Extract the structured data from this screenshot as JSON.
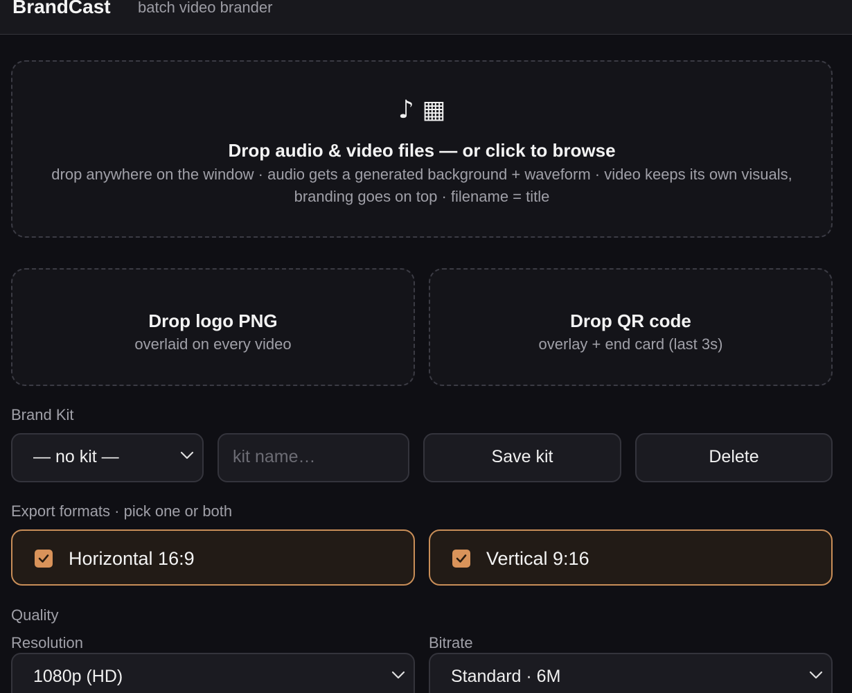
{
  "header": {
    "brand": "BrandCast",
    "tagline": "batch video brander"
  },
  "media_drop": {
    "icons": "♪ ▦",
    "title": "Drop audio & video files — or click to browse",
    "description": "drop anywhere on the window · audio gets a generated background + waveform · video keeps its own visuals, branding goes on top · filename = title"
  },
  "logo_drop": {
    "title": "Drop logo PNG",
    "description": "overlaid on every video"
  },
  "qr_drop": {
    "title": "Drop QR code",
    "description": "overlay + end card (last 3s)"
  },
  "brand_kit": {
    "label": "Brand Kit",
    "selected": "— no kit —",
    "name_placeholder": "kit name…",
    "save_label": "Save kit",
    "delete_label": "Delete"
  },
  "export": {
    "label": "Export formats · pick one or both",
    "formats": [
      {
        "label": "Horizontal 16:9",
        "checked": true
      },
      {
        "label": "Vertical 9:16",
        "checked": true
      }
    ]
  },
  "quality": {
    "label": "Quality",
    "resolution_label": "Resolution",
    "resolution_value": "1080p (HD)",
    "bitrate_label": "Bitrate",
    "bitrate_value": "Standard · 6M"
  },
  "colors": {
    "accent": "#d9935a",
    "accent_border": "#c98e58",
    "background": "#0f0f14"
  }
}
